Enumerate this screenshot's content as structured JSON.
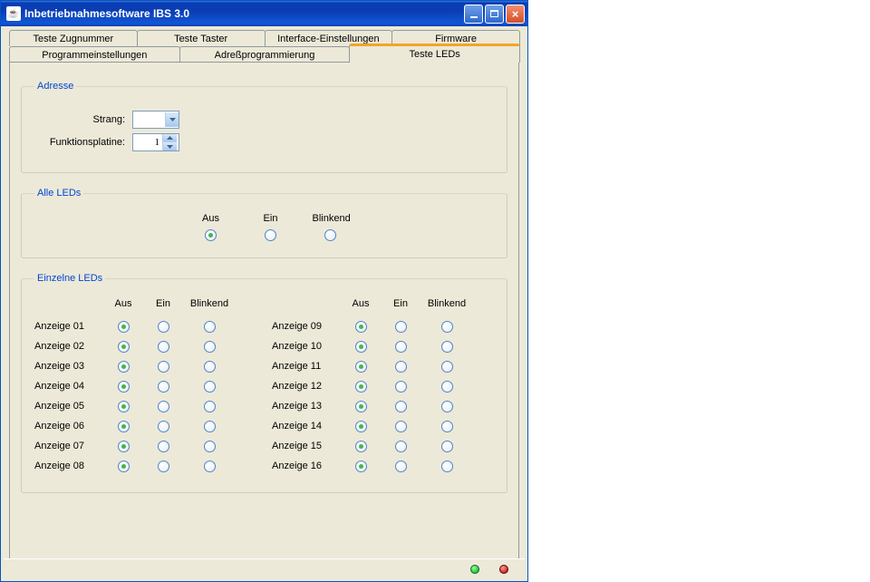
{
  "window": {
    "title": "Inbetriebnahmesoftware IBS 3.0"
  },
  "tabs": {
    "upper": [
      {
        "label": "Teste Zugnummer"
      },
      {
        "label": "Teste Taster"
      },
      {
        "label": "Interface-Einstellungen"
      },
      {
        "label": "Firmware"
      }
    ],
    "lower": [
      {
        "label": "Programmeinstellungen"
      },
      {
        "label": "Adreßprogrammierung"
      },
      {
        "label": "Teste LEDs",
        "active": true
      }
    ]
  },
  "adresse": {
    "legend": "Adresse",
    "strang_label": "Strang:",
    "strang_value": "",
    "funktionsplatine_label": "Funktionsplatine:",
    "funktionsplatine_value": "1"
  },
  "alle_leds": {
    "legend": "Alle LEDs",
    "headers": {
      "aus": "Aus",
      "ein": "Ein",
      "blinkend": "Blinkend"
    },
    "selected": "aus"
  },
  "einzelne_leds": {
    "legend": "Einzelne LEDs",
    "headers": {
      "aus": "Aus",
      "ein": "Ein",
      "blinkend": "Blinkend"
    },
    "left": [
      {
        "label": "Anzeige 01",
        "sel": "aus"
      },
      {
        "label": "Anzeige 02",
        "sel": "aus"
      },
      {
        "label": "Anzeige 03",
        "sel": "aus"
      },
      {
        "label": "Anzeige 04",
        "sel": "aus"
      },
      {
        "label": "Anzeige 05",
        "sel": "aus"
      },
      {
        "label": "Anzeige 06",
        "sel": "aus"
      },
      {
        "label": "Anzeige 07",
        "sel": "aus"
      },
      {
        "label": "Anzeige 08",
        "sel": "aus"
      }
    ],
    "right": [
      {
        "label": "Anzeige 09",
        "sel": "aus"
      },
      {
        "label": "Anzeige 10",
        "sel": "aus"
      },
      {
        "label": "Anzeige 11",
        "sel": "aus"
      },
      {
        "label": "Anzeige 12",
        "sel": "aus"
      },
      {
        "label": "Anzeige 13",
        "sel": "aus"
      },
      {
        "label": "Anzeige 14",
        "sel": "aus"
      },
      {
        "label": "Anzeige 15",
        "sel": "aus"
      },
      {
        "label": "Anzeige 16",
        "sel": "aus"
      }
    ]
  },
  "status": {
    "led1": "green",
    "led2": "red"
  }
}
